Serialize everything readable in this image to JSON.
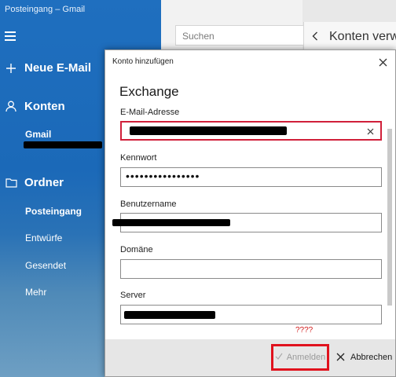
{
  "window": {
    "title": "Posteingang – Gmail"
  },
  "nav": {
    "new_mail": "Neue E-Mail",
    "accounts": "Konten",
    "account_name": "Gmail",
    "folders": "Ordner",
    "folder_items": [
      "Posteingang",
      "Entwürfe",
      "Gesendet",
      "Mehr"
    ]
  },
  "search": {
    "placeholder": "Suchen"
  },
  "right_panel": {
    "title": "Konten verw"
  },
  "dialog": {
    "title": "Konto hinzufügen",
    "heading": "Exchange",
    "email_label": "E-Mail-Adresse",
    "password_label": "Kennwort",
    "password_value": "••••••••••••••••",
    "username_label": "Benutzername",
    "domain_label": "Domäne",
    "server_label": "Server",
    "annotation": "????",
    "login_label": "Anmelden",
    "cancel_label": "Abbrechen"
  },
  "colors": {
    "nav_blue": "#1f6fbf",
    "focus_red": "#d0203a",
    "highlight_red": "#e0121d"
  },
  "icons": [
    "hamburger-icon",
    "plus-icon",
    "person-icon",
    "folder-icon",
    "back-arrow-icon",
    "close-icon",
    "clear-icon",
    "check-icon",
    "cancel-x-icon"
  ]
}
